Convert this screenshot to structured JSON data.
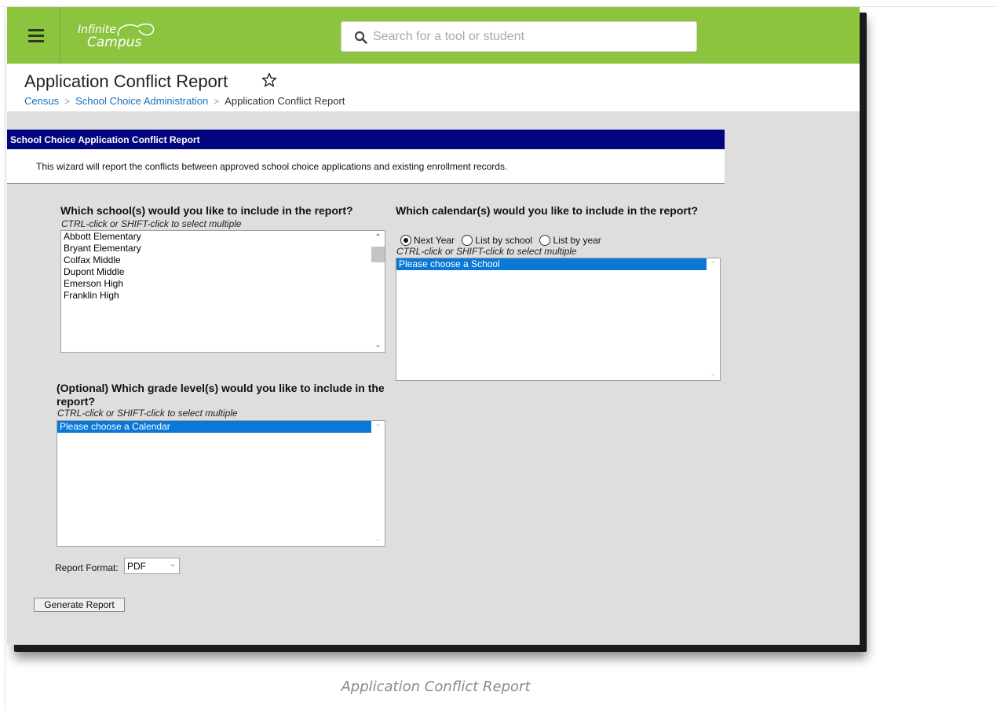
{
  "app": {
    "logo_line1": "Infinite",
    "logo_line2": "Campus",
    "search_placeholder": "Search for a tool or student",
    "brand_color": "#8cc43f"
  },
  "page": {
    "title": "Application Conflict Report",
    "breadcrumb": [
      "Census",
      "School Choice Administration",
      "Application Conflict Report"
    ]
  },
  "panel": {
    "header": "School Choice Application Conflict Report",
    "description": "This wizard will report the conflicts between approved school choice applications and existing enrollment records.",
    "header_color": "#030580"
  },
  "schools": {
    "question": "Which school(s) would you like to include in the report?",
    "hint": "CTRL-click or SHIFT-click to select multiple",
    "options": [
      "Abbott Elementary",
      "Bryant Elementary",
      "Colfax Middle",
      "Dupont Middle",
      "Emerson High",
      "Franklin High"
    ]
  },
  "calendars": {
    "question": "Which calendar(s) would you like to include in the report?",
    "hint": "CTRL-click or SHIFT-click to select multiple",
    "radio_options": [
      "Next Year",
      "List by school",
      "List by year"
    ],
    "radio_selected": "Next Year",
    "options": [
      "Please choose a School"
    ]
  },
  "grades": {
    "question": "(Optional) Which grade level(s) would you like to include in the report?",
    "hint": "CTRL-click or SHIFT-click to select multiple",
    "options": [
      "Please choose a Calendar"
    ]
  },
  "format": {
    "label": "Report Format:",
    "selected": "PDF"
  },
  "actions": {
    "generate_label": "Generate Report"
  },
  "caption": "Application Conflict Report"
}
